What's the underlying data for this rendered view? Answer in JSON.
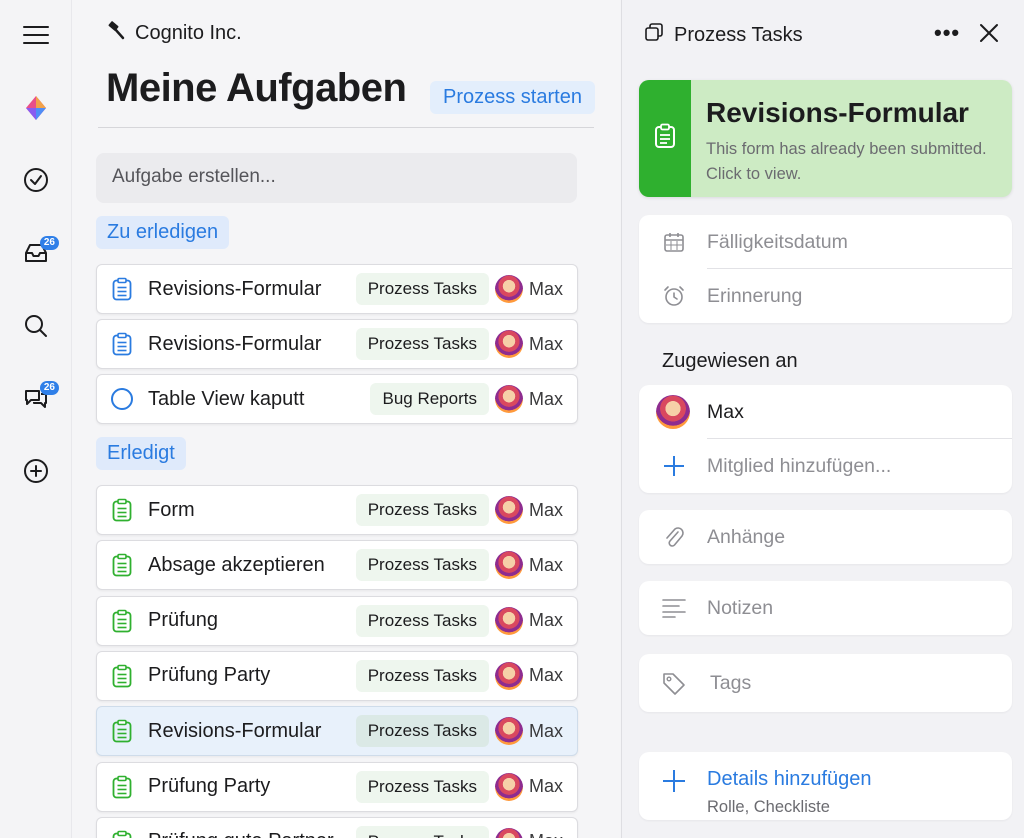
{
  "rail": {
    "inbox_badge": "26",
    "chat_badge": "26"
  },
  "main": {
    "org_name": "Cognito Inc.",
    "title": "Meine Aufgaben",
    "start_process": "Prozess starten",
    "create_placeholder": "Aufgabe erstellen...",
    "section_todo": "Zu erledigen",
    "section_done": "Erledigt",
    "todo": [
      {
        "name": "Revisions-Formular",
        "tag": "Prozess Tasks",
        "assignee": "Max",
        "icon": "clipboard-icon"
      },
      {
        "name": "Revisions-Formular",
        "tag": "Prozess Tasks",
        "assignee": "Max",
        "icon": "clipboard-icon"
      },
      {
        "name": "Table View kaputt",
        "tag": "Bug Reports",
        "assignee": "Max",
        "icon": "circle-icon"
      }
    ],
    "done": [
      {
        "name": "Form",
        "tag": "Prozess Tasks",
        "assignee": "Max"
      },
      {
        "name": "Absage akzeptieren",
        "tag": "Prozess Tasks",
        "assignee": "Max"
      },
      {
        "name": "Prüfung",
        "tag": "Prozess Tasks",
        "assignee": "Max"
      },
      {
        "name": "Prüfung Party",
        "tag": "Prozess Tasks",
        "assignee": "Max"
      },
      {
        "name": "Revisions-Formular",
        "tag": "Prozess Tasks",
        "assignee": "Max"
      },
      {
        "name": "Prüfung Party",
        "tag": "Prozess Tasks",
        "assignee": "Max"
      },
      {
        "name": "Prüfung gute Partner",
        "tag": "Prozess Tasks",
        "assignee": "Max"
      }
    ]
  },
  "side": {
    "title": "Prozess Tasks",
    "form_title": "Revisions-Formular",
    "form_subtitle": "This form has already been submitted. Click to view.",
    "due_date": "Fälligkeitsdatum",
    "reminder": "Erinnerung",
    "assigned_label": "Zugewiesen an",
    "assignee": "Max",
    "add_member": "Mitglied hinzufügen...",
    "attachments": "Anhänge",
    "notes": "Notizen",
    "tags": "Tags",
    "add_details": "Details hinzufügen",
    "add_details_sub": "Rolle, Checkliste"
  },
  "colors": {
    "accent": "#2a7be0",
    "done_green": "#2fb02f",
    "form_card_bg": "#cdebc4"
  }
}
